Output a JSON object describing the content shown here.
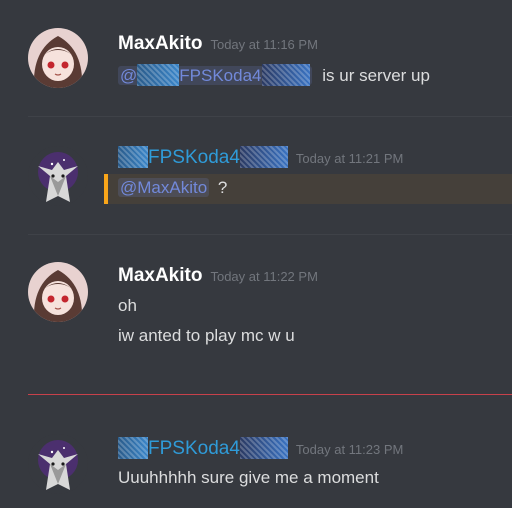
{
  "messages": [
    {
      "author": "MaxAkito",
      "timestamp": "Today at 11:16 PM",
      "mention": "@",
      "mention_name": "FPSKoda4",
      "text": "is ur server up"
    },
    {
      "author": "FPSKoda4",
      "timestamp": "Today at 11:21 PM",
      "mention": "@MaxAkito",
      "text": "?"
    },
    {
      "author": "MaxAkito",
      "timestamp": "Today at 11:22 PM",
      "lines": [
        "oh",
        "iw anted to play mc w u"
      ]
    },
    {
      "author": "FPSKoda4",
      "timestamp": "Today at 11:23 PM",
      "text": "Uuuhhhhh sure give me a moment"
    }
  ],
  "colors": {
    "background": "#36393f",
    "username_default": "#ffffff",
    "username_role": "#2f9bd8",
    "mention": "#7289da",
    "highlight_bar": "#faa61a",
    "new_messages_divider": "#e0434d"
  },
  "icons": {
    "maxakito_avatar": "anime-girl-avatar",
    "fpskoda4_avatar": "wolf-avatar"
  }
}
